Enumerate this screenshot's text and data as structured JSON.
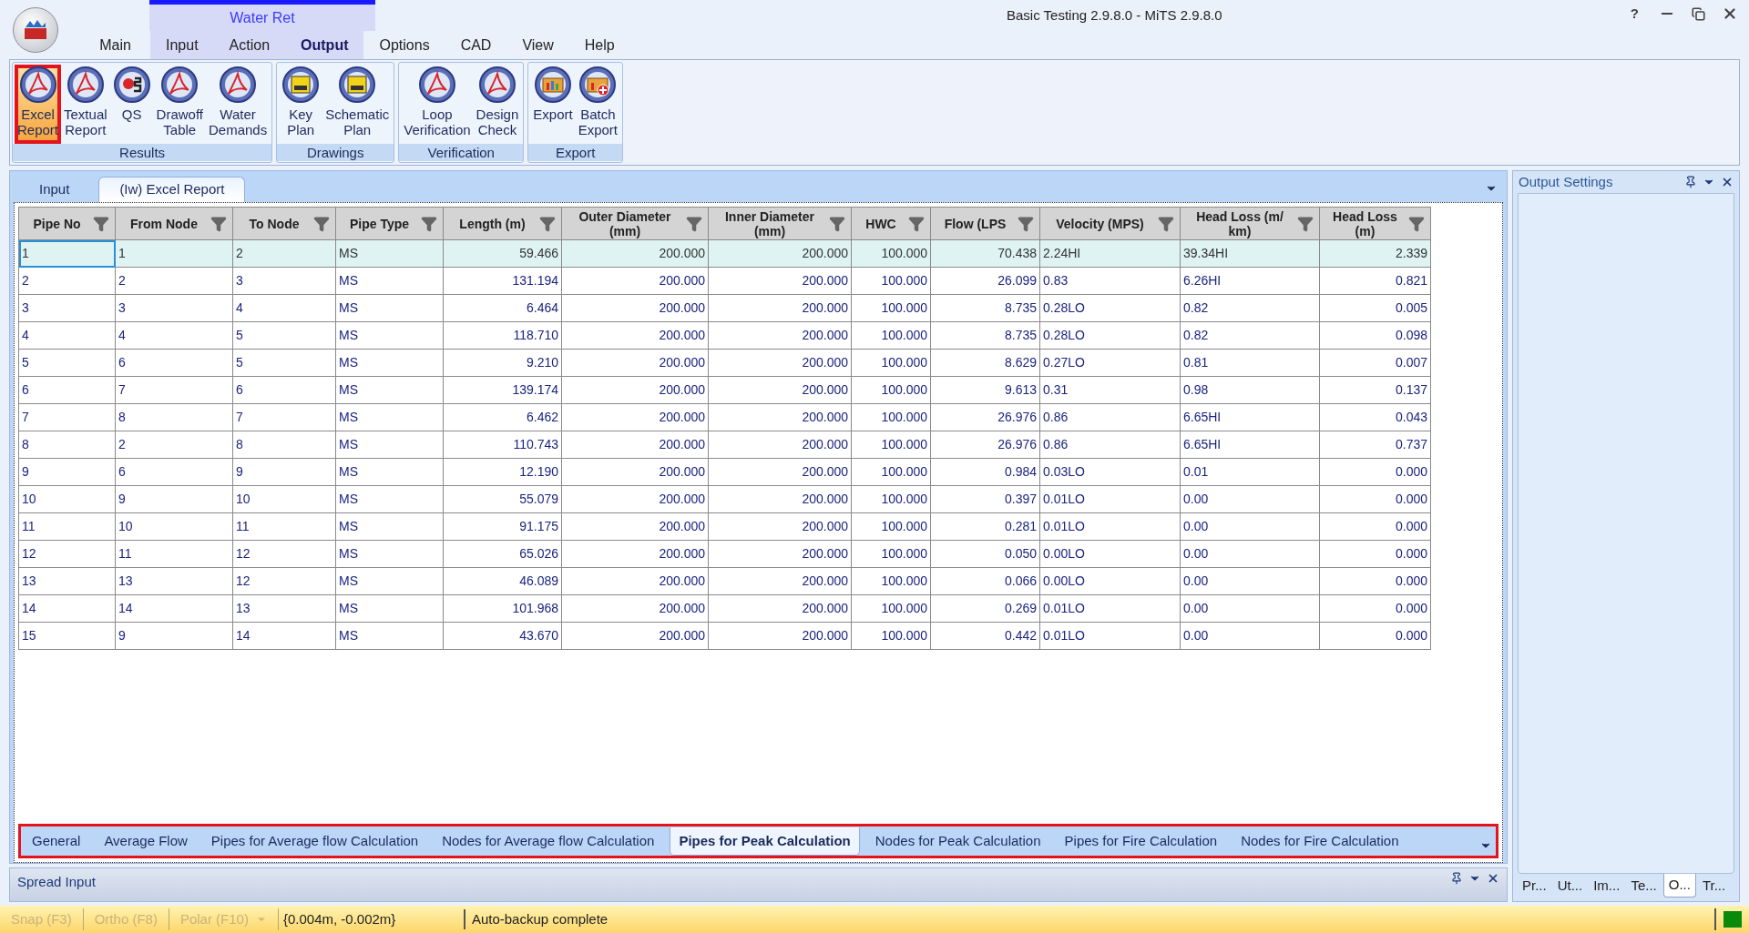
{
  "window": {
    "title": "Basic Testing 2.9.8.0 - MiTS 2.9.8.0",
    "help_button": "?"
  },
  "context_tab": "Water Ret",
  "menu_tabs": [
    {
      "label": "Main",
      "selected": false,
      "contextual": false
    },
    {
      "label": "Input",
      "selected": false,
      "contextual": true
    },
    {
      "label": "Action",
      "selected": false,
      "contextual": true
    },
    {
      "label": "Output",
      "selected": true,
      "contextual": true
    },
    {
      "label": "Options",
      "selected": false,
      "contextual": false
    },
    {
      "label": "CAD",
      "selected": false,
      "contextual": false
    },
    {
      "label": "View",
      "selected": false,
      "contextual": false
    },
    {
      "label": "Help",
      "selected": false,
      "contextual": false
    }
  ],
  "ribbon_groups": [
    {
      "name": "Results",
      "buttons": [
        {
          "label": "Excel Report",
          "kind": "report",
          "selected": true
        },
        {
          "label": "Textual Report",
          "kind": "report",
          "selected": false
        },
        {
          "label": "QS",
          "kind": "qs",
          "selected": false
        },
        {
          "label": "Drawoff Table",
          "kind": "report",
          "selected": false
        },
        {
          "label": "Water Demands",
          "kind": "report",
          "selected": false
        }
      ]
    },
    {
      "name": "Drawings",
      "buttons": [
        {
          "label": "Key Plan",
          "kind": "dwg",
          "selected": false
        },
        {
          "label": "Schematic Plan",
          "kind": "dwg",
          "selected": false
        }
      ]
    },
    {
      "name": "Verification",
      "buttons": [
        {
          "label": "Loop Verification",
          "kind": "report",
          "selected": false
        },
        {
          "label": "Design Check",
          "kind": "report",
          "selected": false
        }
      ]
    },
    {
      "name": "Export",
      "buttons": [
        {
          "label": "Export",
          "kind": "export",
          "selected": false
        },
        {
          "label": "Batch Export",
          "kind": "batch",
          "selected": false
        }
      ]
    }
  ],
  "document_tabs": [
    {
      "label": "Input",
      "selected": false
    },
    {
      "label": "(Iw) Excel Report",
      "selected": true
    }
  ],
  "table": {
    "columns": [
      {
        "label": "Pipe No",
        "kind": "text"
      },
      {
        "label": "From Node",
        "kind": "text"
      },
      {
        "label": "To Node",
        "kind": "text"
      },
      {
        "label": "Pipe Type",
        "kind": "text"
      },
      {
        "label": "Length (m)",
        "kind": "number"
      },
      {
        "label": "Outer Diameter (mm)",
        "kind": "number"
      },
      {
        "label": "Inner Diameter (mm)",
        "kind": "number"
      },
      {
        "label": "HWC",
        "kind": "number"
      },
      {
        "label": "Flow (LPS",
        "kind": "number"
      },
      {
        "label": "Velocity (MPS)",
        "kind": "text"
      },
      {
        "label": "Head Loss (m/ km)",
        "kind": "text"
      },
      {
        "label": "Head Loss (m)",
        "kind": "number"
      }
    ],
    "rows": [
      {
        "selected": true,
        "cells": [
          "1",
          "1",
          "2",
          "MS",
          "59.466",
          "200.000",
          "200.000",
          "100.000",
          "70.438",
          "2.24HI",
          "39.34HI",
          "2.339"
        ]
      },
      {
        "selected": false,
        "cells": [
          "2",
          "2",
          "3",
          "MS",
          "131.194",
          "200.000",
          "200.000",
          "100.000",
          "26.099",
          "0.83",
          "6.26HI",
          "0.821"
        ]
      },
      {
        "selected": false,
        "cells": [
          "3",
          "3",
          "4",
          "MS",
          "6.464",
          "200.000",
          "200.000",
          "100.000",
          "8.735",
          "0.28LO",
          "0.82",
          "0.005"
        ]
      },
      {
        "selected": false,
        "cells": [
          "4",
          "4",
          "5",
          "MS",
          "118.710",
          "200.000",
          "200.000",
          "100.000",
          "8.735",
          "0.28LO",
          "0.82",
          "0.098"
        ]
      },
      {
        "selected": false,
        "cells": [
          "5",
          "6",
          "5",
          "MS",
          "9.210",
          "200.000",
          "200.000",
          "100.000",
          "8.629",
          "0.27LO",
          "0.81",
          "0.007"
        ]
      },
      {
        "selected": false,
        "cells": [
          "6",
          "7",
          "6",
          "MS",
          "139.174",
          "200.000",
          "200.000",
          "100.000",
          "9.613",
          "0.31",
          "0.98",
          "0.137"
        ]
      },
      {
        "selected": false,
        "cells": [
          "7",
          "8",
          "7",
          "MS",
          "6.462",
          "200.000",
          "200.000",
          "100.000",
          "26.976",
          "0.86",
          "6.65HI",
          "0.043"
        ]
      },
      {
        "selected": false,
        "cells": [
          "8",
          "2",
          "8",
          "MS",
          "110.743",
          "200.000",
          "200.000",
          "100.000",
          "26.976",
          "0.86",
          "6.65HI",
          "0.737"
        ]
      },
      {
        "selected": false,
        "cells": [
          "9",
          "6",
          "9",
          "MS",
          "12.190",
          "200.000",
          "200.000",
          "100.000",
          "0.984",
          "0.03LO",
          "0.01",
          "0.000"
        ]
      },
      {
        "selected": false,
        "cells": [
          "10",
          "9",
          "10",
          "MS",
          "55.079",
          "200.000",
          "200.000",
          "100.000",
          "0.397",
          "0.01LO",
          "0.00",
          "0.000"
        ]
      },
      {
        "selected": false,
        "cells": [
          "11",
          "10",
          "11",
          "MS",
          "91.175",
          "200.000",
          "200.000",
          "100.000",
          "0.281",
          "0.01LO",
          "0.00",
          "0.000"
        ]
      },
      {
        "selected": false,
        "cells": [
          "12",
          "11",
          "12",
          "MS",
          "65.026",
          "200.000",
          "200.000",
          "100.000",
          "0.050",
          "0.00LO",
          "0.00",
          "0.000"
        ]
      },
      {
        "selected": false,
        "cells": [
          "13",
          "13",
          "12",
          "MS",
          "46.089",
          "200.000",
          "200.000",
          "100.000",
          "0.066",
          "0.00LO",
          "0.00",
          "0.000"
        ]
      },
      {
        "selected": false,
        "cells": [
          "14",
          "14",
          "13",
          "MS",
          "101.968",
          "200.000",
          "200.000",
          "100.000",
          "0.269",
          "0.01LO",
          "0.00",
          "0.000"
        ]
      },
      {
        "selected": false,
        "cells": [
          "15",
          "9",
          "14",
          "MS",
          "43.670",
          "200.000",
          "200.000",
          "100.000",
          "0.442",
          "0.01LO",
          "0.00",
          "0.000"
        ]
      }
    ]
  },
  "sheet_tabs": [
    {
      "label": "General",
      "selected": false
    },
    {
      "label": "Average Flow",
      "selected": false
    },
    {
      "label": "Pipes for Average flow Calculation",
      "selected": false
    },
    {
      "label": "Nodes for Average flow Calculation",
      "selected": false
    },
    {
      "label": "Pipes for Peak Calculation",
      "selected": true
    },
    {
      "label": "Nodes for Peak Calculation",
      "selected": false
    },
    {
      "label": "Pipes for Fire Calculation",
      "selected": false
    },
    {
      "label": "Nodes for Fire Calculation",
      "selected": false
    }
  ],
  "spread_panel": {
    "title": "Spread Input"
  },
  "output_panel": {
    "title": "Output Settings",
    "tabs": [
      {
        "label": "Pr...",
        "selected": false
      },
      {
        "label": "Ut...",
        "selected": false
      },
      {
        "label": "Im...",
        "selected": false
      },
      {
        "label": "Te...",
        "selected": false
      },
      {
        "label": "O...",
        "selected": true
      },
      {
        "label": "Tr...",
        "selected": false
      }
    ]
  },
  "status_bar": {
    "toggles": [
      {
        "label": "Snap (F3)",
        "disabled": true,
        "dropdown": false
      },
      {
        "label": "Ortho (F8)",
        "disabled": true,
        "dropdown": false
      },
      {
        "label": "Polar (F10)",
        "disabled": true,
        "dropdown": true
      }
    ],
    "coordinates": "{0.004m, -0.002m}",
    "message": "Auto-backup complete",
    "indicator_on": true
  }
}
